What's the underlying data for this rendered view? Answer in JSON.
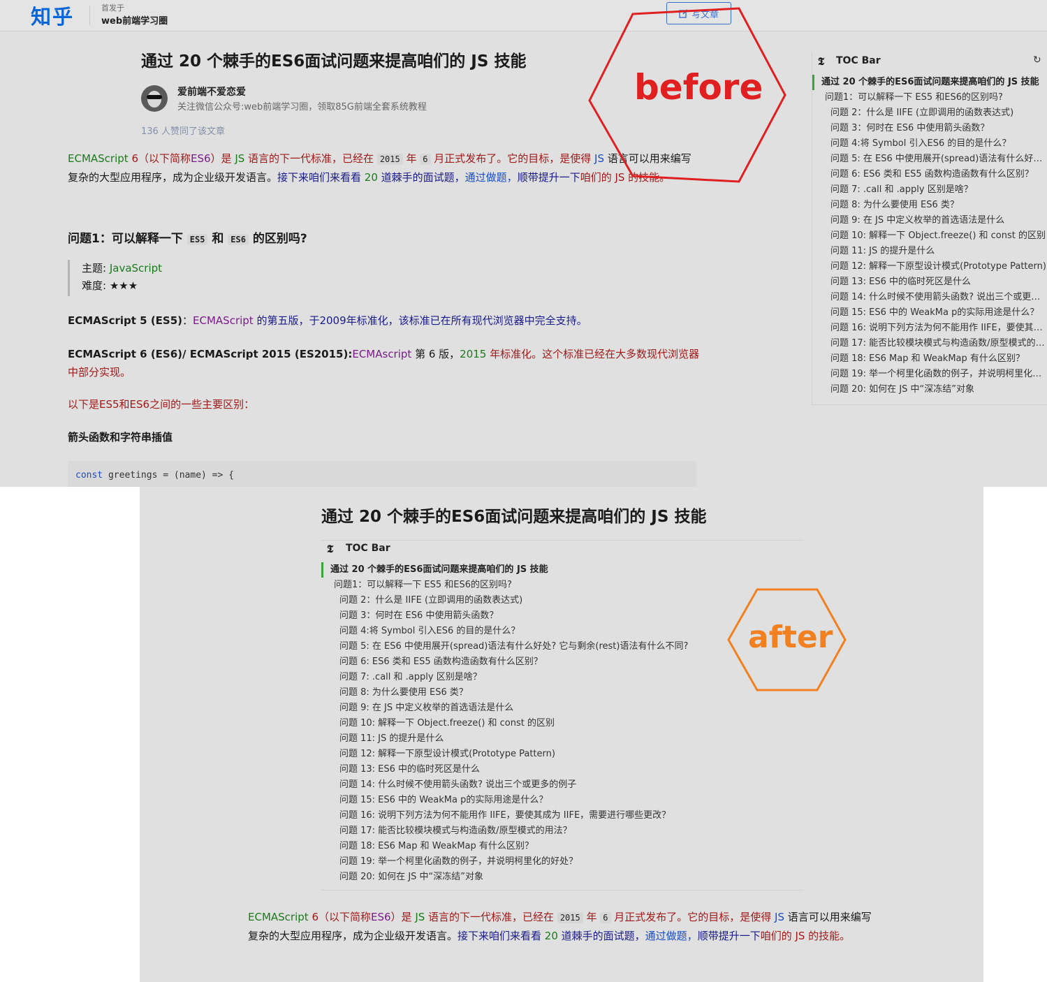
{
  "header": {
    "logo": "知乎",
    "published_in": "首发于",
    "column_name": "web前端学习圈",
    "write_button": "写文章"
  },
  "article": {
    "title": "通过 20 个棘手的ES6面试问题来提高咱们的 JS 技能",
    "author_name": "爱前端不爱恋爱",
    "author_bio": "关注微信公众号:web前端学习圈，领取85G前端全套系统教程",
    "likes": "136 人赞同了该文章",
    "intro": {
      "p1_green": "ECMAScript",
      "p1_red": " 6（以下简称",
      "p1_purple": "ES6",
      "p1_red2": "）是 ",
      "p1_green2": "JS",
      "p1_red3": " 语言的下一代标准，已经在 ",
      "p1_code1": "2015",
      "p1_red4": " 年 ",
      "p1_code2": "6",
      "p1_red5": " 月正式发布了。它的目标，是使得 ",
      "p1_blue1": "JS",
      "p1_dark": " 语言可以用来编写复杂的大型应用程序，成为企业级开发语言。",
      "p1_navy": "接下来咱们来看看 ",
      "p1_green3": "20",
      "p1_navy2": " 道棘手的面试题，",
      "p1_blue2": "通过做题，",
      "p1_navy3": "顺带提升一下",
      "p1_red6": "咱们的 JS 的技能。"
    },
    "q1_heading_pre": "问题1：可以解释一下 ",
    "q1_code1": "ES5",
    "q1_mid": " 和 ",
    "q1_code2": "ES6",
    "q1_post": " 的区别吗?",
    "topic_label": "主题: ",
    "topic_value": "JavaScript",
    "difficulty_label": "难度: ",
    "difficulty_value": "★★★",
    "es5_bold": "ECMAScript 5 (ES5)",
    "es5_colon": "：",
    "es5_purple": "ECMAScript",
    "es5_rest": " 的第五版，于2009年标准化，该标准已在所有现代浏览器中完全支持。",
    "es6_bold": "ECMAScript 6 (ES6)/ ECMAScript 2015 (ES2015):",
    "es6_purple": "ECMAscript",
    "es6_dark": " 第 6 版，",
    "es6_green": "2015",
    "es6_rest": " 年标准化。这个标准已经在大多数现代浏览器中部分实现。",
    "diff_intro": "以下是ES5和ES6之间的一些主要区别：",
    "arrow_heading": "箭头函数和字符串插值",
    "code_kw": "const",
    "code_rest": " greetings = (name) => {"
  },
  "toc": {
    "title": "TOC Bar",
    "refresh_icon": "↻",
    "items": [
      "通过 20 个棘手的ES6面试问题来提高咱们的 JS 技能",
      "问题1：可以解释一下 ES5 和ES6的区别吗?",
      "问题 2：什么是 IIFE (立即调用的函数表达式)",
      "问题 3：何时在 ES6 中使用箭头函数？",
      "问题 4:将 Symbol 引入ES6 的目的是什么？",
      "问题 5: 在 ES6 中使用展开(spread)语法有什么好处? 它与剩余(rest)语法有什么不同?",
      "问题 6: ES6 类和 ES5 函数构造函数有什么区别？",
      "问题 7: .call 和 .apply 区别是啥？",
      "问题 8: 为什么要使用 ES6 类？",
      "问题 9: 在 JS 中定义枚举的首选语法是什么",
      "问题 10: 解释一下 Object.freeze() 和 const 的区别",
      "问题 11: JS 的提升是什么",
      "问题 12: 解释一下原型设计模式(Prototype Pattern)",
      "问题 13: ES6 中的临时死区是什么",
      "问题 14: 什么时候不使用箭头函数? 说出三个或更多的例子",
      "问题 15: ES6 中的 WeakMa p的实际用途是什么？",
      "问题 16: 说明下列方法为何不能用作 IIFE，要使其成为 IIFE，需要进行哪些更改？",
      "问题 17: 能否比较模块模式与构造函数/原型模式的用法？",
      "问题 18: ES6 Map 和 WeakMap 有什么区别？",
      "问题 19: 举一个柯里化函数的例子，并说明柯里化的好处？",
      "问题 20: 如何在 JS 中“深冻结”对象"
    ]
  },
  "annotations": {
    "before_label": "before",
    "before_color": "#e02020",
    "after_label": "after",
    "after_color": "#f08020"
  },
  "colors": {
    "accent_blue": "#0a66d8",
    "toc_active": "#3aa33a",
    "panel_bg": "#e0e0e0"
  }
}
